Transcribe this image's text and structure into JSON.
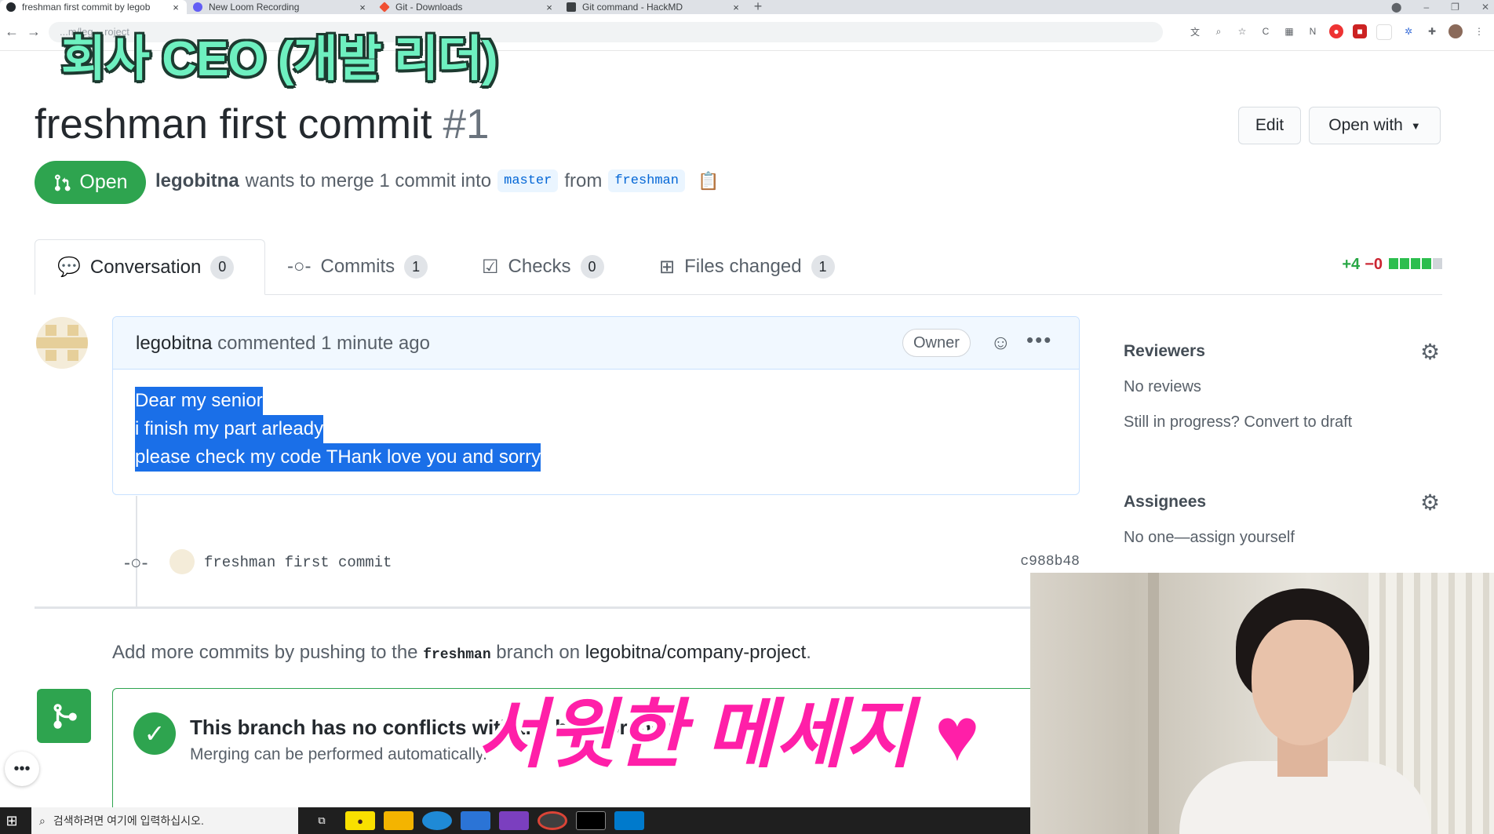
{
  "browser": {
    "tabs": [
      {
        "title": "freshman first commit by legob",
        "active": true
      },
      {
        "title": "New Loom Recording",
        "active": false
      },
      {
        "title": "Git - Downloads",
        "active": false
      },
      {
        "title": "Git command - HackMD",
        "active": false
      }
    ],
    "new_tab": "+",
    "address": "...m/leg....roject"
  },
  "overlay": {
    "top_caption": "회사 CEO (개발 리더)",
    "bottom_caption": "서윗한 메세지 ♥"
  },
  "pr": {
    "title": "freshman first commit",
    "number": "#1",
    "edit_label": "Edit",
    "open_with_label": "Open with",
    "state": "Open",
    "author": "legobitna",
    "meta_prefix": "wants to merge 1 commit into",
    "base_branch": "master",
    "meta_from": "from",
    "head_branch": "freshman"
  },
  "tabs": {
    "conversation": {
      "label": "Conversation",
      "count": "0"
    },
    "commits": {
      "label": "Commits",
      "count": "1"
    },
    "checks": {
      "label": "Checks",
      "count": "0"
    },
    "files": {
      "label": "Files changed",
      "count": "1"
    },
    "diff_add": "+4",
    "diff_del": "−0"
  },
  "comment": {
    "author": "legobitna",
    "action": "commented",
    "time": "1 minute ago",
    "badge": "Owner",
    "lines": [
      "Dear my senior",
      "i finish my part arleady",
      "please check my code THank love you and sorry"
    ]
  },
  "commit": {
    "message": "freshman first commit",
    "sha": "c988b48"
  },
  "add_more": {
    "prefix": "Add more commits by pushing to the",
    "branch": "freshman",
    "middle": "branch on",
    "repo": "legobitna/company-project",
    "suffix": "."
  },
  "merge": {
    "title": "This branch has no conflicts with the base branch",
    "subtitle": "Merging can be performed automatically."
  },
  "sidebar": {
    "reviewers_heading": "Reviewers",
    "reviewers_value": "No reviews",
    "draft_text": "Still in progress? Convert to draft",
    "assignees_heading": "Assignees",
    "assignees_value": "No one—assign yourself"
  },
  "taskbar": {
    "search_placeholder": "검색하려면 여기에 입력하십시오."
  },
  "colors": {
    "open_green": "#2ea44f",
    "link_blue": "#0366d6",
    "selection_blue": "#1a6fe8",
    "caption_mint": "#6ef0c0",
    "caption_pink": "#ff1fa8"
  }
}
